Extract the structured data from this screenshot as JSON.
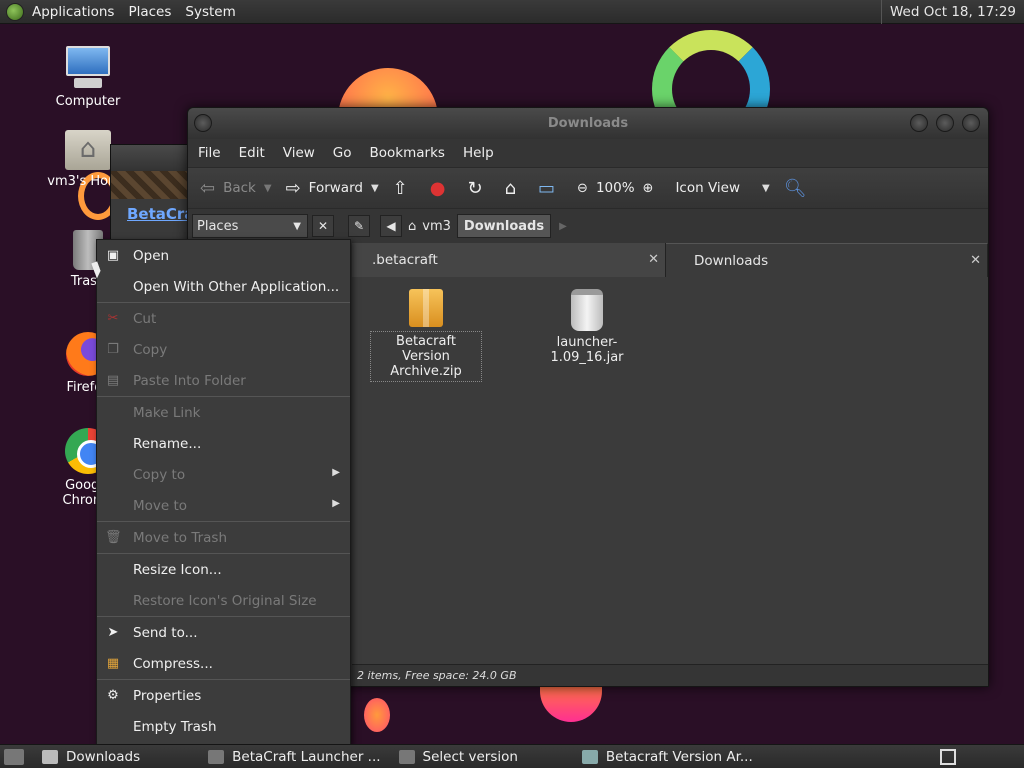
{
  "top_panel": {
    "menus": [
      "Applications",
      "Places",
      "System"
    ],
    "clock": "Wed Oct 18, 17:29"
  },
  "desktop": {
    "icons": [
      {
        "label": "Computer",
        "icon": "computer-icon"
      },
      {
        "label": "vm3's Home",
        "icon": "home-folder-icon"
      },
      {
        "label": "Trash",
        "icon": "trash-icon"
      },
      {
        "label": "Firefox",
        "icon": "firefox-icon"
      },
      {
        "label": "Google Chrome",
        "icon": "chrome-icon"
      }
    ]
  },
  "back_window": {
    "title": "BetaCraft"
  },
  "file_manager": {
    "title": "Downloads",
    "menubar": [
      "File",
      "Edit",
      "View",
      "Go",
      "Bookmarks",
      "Help"
    ],
    "toolbar": {
      "back": "Back",
      "forward": "Forward",
      "zoom": "100%",
      "view_mode": "Icon View"
    },
    "location": {
      "places": "Places",
      "crumbs": [
        "vm3",
        "Downloads"
      ]
    },
    "tabs": [
      {
        "label": ".betacraft",
        "active": false
      },
      {
        "label": "Downloads",
        "active": true
      }
    ],
    "files": [
      {
        "name": "Betacraft Version Archive.zip",
        "icon": "zip-archive-icon"
      },
      {
        "name": "launcher-1.09_16.jar",
        "icon": "jar-file-icon"
      }
    ],
    "status": "2 items, Free space: 24.0 GB"
  },
  "context_menu": {
    "items": [
      {
        "label": "Open",
        "enabled": true,
        "icon": "open-icon"
      },
      {
        "label": "Open With Other Application...",
        "enabled": true
      },
      {
        "label": "Cut",
        "enabled": false,
        "icon": "scissors-icon"
      },
      {
        "label": "Copy",
        "enabled": false,
        "icon": "copy-icon"
      },
      {
        "label": "Paste Into Folder",
        "enabled": false,
        "icon": "paste-icon"
      },
      {
        "label": "Make Link",
        "enabled": false
      },
      {
        "label": "Rename...",
        "enabled": true
      },
      {
        "label": "Copy to",
        "enabled": false,
        "submenu": true
      },
      {
        "label": "Move to",
        "enabled": false,
        "submenu": true
      },
      {
        "label": "Move to Trash",
        "enabled": false,
        "icon": "trash-icon"
      },
      {
        "label": "Resize Icon...",
        "enabled": true
      },
      {
        "label": "Restore Icon's Original Size",
        "enabled": false
      },
      {
        "label": "Send to...",
        "enabled": true,
        "icon": "send-icon"
      },
      {
        "label": "Compress...",
        "enabled": true,
        "icon": "compress-icon"
      },
      {
        "label": "Properties",
        "enabled": true,
        "icon": "properties-icon"
      },
      {
        "label": "Empty Trash",
        "enabled": true
      }
    ]
  },
  "taskbar": {
    "tasks": [
      {
        "label": "Downloads",
        "icon": "folder-icon"
      },
      {
        "label": "BetaCraft Launcher ...",
        "icon": "java-icon"
      },
      {
        "label": "Select version",
        "icon": "java-icon"
      },
      {
        "label": "Betacraft Version Ar...",
        "icon": "archive-manager-icon"
      }
    ]
  }
}
